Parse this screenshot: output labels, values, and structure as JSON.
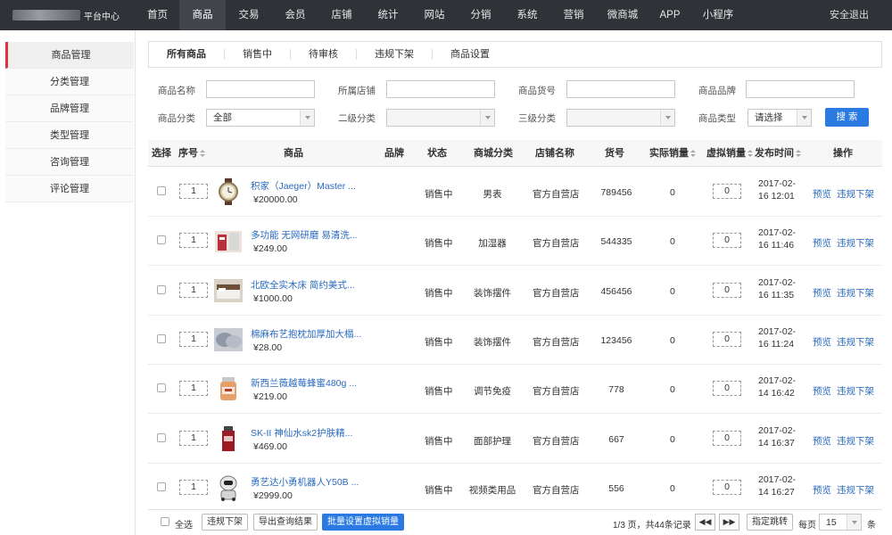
{
  "brand": {
    "title": "平台中心"
  },
  "nav": {
    "items": [
      "首页",
      "商品",
      "交易",
      "会员",
      "店铺",
      "统计",
      "网站",
      "分销",
      "系统",
      "营销",
      "微商城",
      "APP",
      "小程序"
    ],
    "active": "商品",
    "logout": "安全退出"
  },
  "sidebar": {
    "items": [
      "商品管理",
      "分类管理",
      "品牌管理",
      "类型管理",
      "咨询管理",
      "评论管理"
    ],
    "active": "商品管理"
  },
  "tabs": [
    "所有商品",
    "销售中",
    "待审核",
    "违规下架",
    "商品设置"
  ],
  "filters": {
    "name_label": "商品名称",
    "store_label": "所属店铺",
    "sku_label": "商品货号",
    "brand_label": "商品品牌",
    "category_label": "商品分类",
    "category_value": "全部",
    "sub_category_label": "二级分类",
    "third_category_label": "三级分类",
    "type_label": "商品类型",
    "type_value": "请选择",
    "search_button": "搜 索"
  },
  "table": {
    "headers": [
      "选择",
      "序号",
      "商品",
      "品牌",
      "状态",
      "商城分类",
      "店铺名称",
      "货号",
      "实际销量",
      "虚拟销量",
      "发布时间",
      "操作"
    ],
    "rows": [
      {
        "seq": "1",
        "name": "积家（Jaeger）Master ...",
        "price": "¥20000.00",
        "brand": "",
        "status": "销售中",
        "category": "男表",
        "store": "官方自营店",
        "sku": "789456",
        "actual_sales": "0",
        "virtual_sales": "0",
        "date1": "2017-02-",
        "date2": "16 12:01",
        "thumb": "watch"
      },
      {
        "seq": "1",
        "name": "多功能 无网研磨 易清洗...",
        "price": "¥249.00",
        "brand": "",
        "status": "销售中",
        "category": "加湿器",
        "store": "官方自营店",
        "sku": "544335",
        "actual_sales": "0",
        "virtual_sales": "0",
        "date1": "2017-02-",
        "date2": "16 11:46",
        "thumb": "appliance"
      },
      {
        "seq": "1",
        "name": "北欧全实木床 简约美式...",
        "price": "¥1000.00",
        "brand": "",
        "status": "销售中",
        "category": "装饰摆件",
        "store": "官方自营店",
        "sku": "456456",
        "actual_sales": "0",
        "virtual_sales": "0",
        "date1": "2017-02-",
        "date2": "16 11:35",
        "thumb": "bed"
      },
      {
        "seq": "1",
        "name": "棉麻布艺抱枕加厚加大榻...",
        "price": "¥28.00",
        "brand": "",
        "status": "销售中",
        "category": "装饰摆件",
        "store": "官方自营店",
        "sku": "123456",
        "actual_sales": "0",
        "virtual_sales": "0",
        "date1": "2017-02-",
        "date2": "16 11:24",
        "thumb": "pillow"
      },
      {
        "seq": "1",
        "name": "新西兰薇越莓蜂蜜480g ...",
        "price": "¥219.00",
        "brand": "",
        "status": "销售中",
        "category": "调节免疫",
        "store": "官方自营店",
        "sku": "778",
        "actual_sales": "0",
        "virtual_sales": "0",
        "date1": "2017-02-",
        "date2": "14 16:42",
        "thumb": "honey"
      },
      {
        "seq": "1",
        "name": "SK-II 神仙水sk2护肤精...",
        "price": "¥469.00",
        "brand": "",
        "status": "销售中",
        "category": "面部护理",
        "store": "官方自营店",
        "sku": "667",
        "actual_sales": "0",
        "virtual_sales": "0",
        "date1": "2017-02-",
        "date2": "14 16:37",
        "thumb": "skincare"
      },
      {
        "seq": "1",
        "name": "勇艺达小勇机器人Y50B ...",
        "price": "¥2999.00",
        "brand": "",
        "status": "销售中",
        "category": "视频类用品",
        "store": "官方自营店",
        "sku": "556",
        "actual_sales": "0",
        "virtual_sales": "0",
        "date1": "2017-02-",
        "date2": "14 16:27",
        "thumb": "robot"
      }
    ],
    "action_preview": "预览",
    "action_violation": "违规下架"
  },
  "footer": {
    "select_all": "全选",
    "violation_button": "违规下架",
    "export_button": "导出查询结果",
    "batch_button": "批量设置虚拟销量",
    "page_info": "1/3 页，共44条记录",
    "jump_button": "指定跳转",
    "per_page_label": "每页",
    "per_page_value": "15",
    "per_page_unit": "条"
  }
}
